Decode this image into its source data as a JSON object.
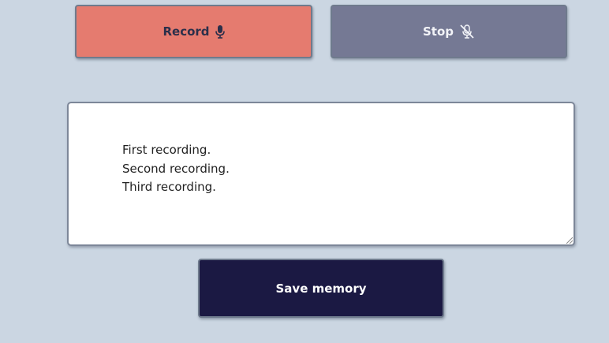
{
  "controls": {
    "record_label": "Record",
    "stop_label": "Stop",
    "record_icon": "microphone-icon",
    "stop_icon": "microphone-slash-icon"
  },
  "memory": {
    "text": "First recording.\nSecond recording.\nThird recording."
  },
  "actions": {
    "save_label": "Save memory"
  },
  "colors": {
    "background": "#cbd6e2",
    "record": "#e57b6f",
    "stop": "#757994",
    "save": "#1b1943"
  }
}
